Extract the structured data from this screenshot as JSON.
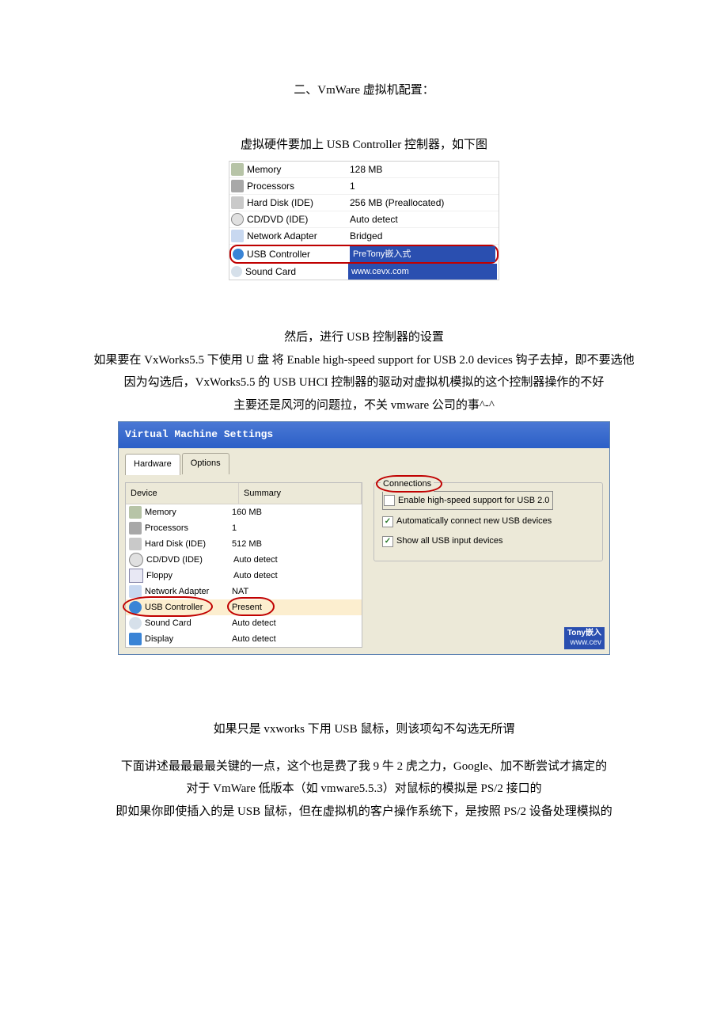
{
  "section_title": "二、VmWare 虚拟机配置：",
  "p1": "虚拟硬件要加上 USB Controller 控制器，如下图",
  "hw1": {
    "rows": [
      {
        "icon": "memory-icon",
        "name": "Memory",
        "value": "128 MB"
      },
      {
        "icon": "cpu-icon",
        "name": "Processors",
        "value": "1"
      },
      {
        "icon": "hdd-icon",
        "name": "Hard Disk (IDE)",
        "value": "256 MB (Preallocated)"
      },
      {
        "icon": "cd-icon",
        "name": "CD/DVD (IDE)",
        "value": "Auto detect"
      },
      {
        "icon": "net-icon",
        "name": "Network Adapter",
        "value": "Bridged"
      },
      {
        "icon": "usb-icon",
        "name": "USB Controller",
        "value": "PreTony嵌入式"
      },
      {
        "icon": "sound-icon",
        "name": "Sound Card",
        "value": "www.cevx.com"
      }
    ]
  },
  "p2": "然后，进行 USB 控制器的设置",
  "p3": "如果要在 VxWorks5.5 下使用 U 盘 将 Enable high-speed support for USB 2.0 devices 钩子去掉，即不要选他",
  "p4": "因为勾选后，VxWorks5.5 的 USB UHCI 控制器的驱动对虚拟机模拟的这个控制器操作的不好",
  "p5": "主要还是风河的问题拉，不关 vmware 公司的事^-^",
  "vmw": {
    "title": "Virtual Machine Settings",
    "tabs": {
      "hardware": "Hardware",
      "options": "Options"
    },
    "cols": {
      "device": "Device",
      "summary": "Summary"
    },
    "rows": [
      {
        "icon": "memory-icon",
        "name": "Memory",
        "summary": "160 MB"
      },
      {
        "icon": "cpu-icon",
        "name": "Processors",
        "summary": "1"
      },
      {
        "icon": "hdd-icon",
        "name": "Hard Disk (IDE)",
        "summary": "512 MB"
      },
      {
        "icon": "cd-icon",
        "name": "CD/DVD (IDE)",
        "summary": "Auto detect"
      },
      {
        "icon": "floppy-icon",
        "name": "Floppy",
        "summary": "Auto detect"
      },
      {
        "icon": "net-icon",
        "name": "Network Adapter",
        "summary": "NAT"
      },
      {
        "icon": "usb-icon",
        "name": "USB Controller",
        "summary": "Present",
        "selected": true
      },
      {
        "icon": "sound-icon",
        "name": "Sound Card",
        "summary": "Auto detect"
      },
      {
        "icon": "display-icon",
        "name": "Display",
        "summary": "Auto detect"
      }
    ],
    "group": {
      "title": "Connections",
      "chk1": "Enable high-speed support for USB 2.0",
      "chk2": "Automatically connect new USB devices",
      "chk3": "Show all USB input devices"
    },
    "badge": {
      "l1": "Tony嵌入",
      "l2": "www.cev"
    }
  },
  "p6": "如果只是 vxworks 下用 USB 鼠标，则该项勾不勾选无所谓",
  "p7": "下面讲述最最最最关键的一点，这个也是费了我 9 牛 2 虎之力，Google、加不断尝试才搞定的",
  "p8": "对于 VmWare 低版本（如 vmware5.5.3）对鼠标的模拟是 PS/2 接口的",
  "p9": "即如果你即使插入的是 USB 鼠标，但在虚拟机的客户操作系统下，是按照 PS/2 设备处理模拟的"
}
